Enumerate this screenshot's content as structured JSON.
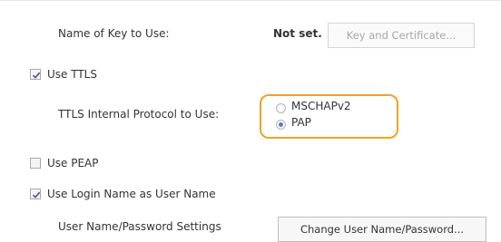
{
  "key": {
    "label": "Name of Key to Use:",
    "value": "Not set.",
    "button": "Key and Certificate..."
  },
  "ttls": {
    "checkbox_label": "Use TTLS",
    "checked": true,
    "protocol_label": "TTLS Internal Protocol to Use:",
    "options": [
      {
        "label": "MSCHAPv2",
        "selected": false
      },
      {
        "label": "PAP",
        "selected": true
      }
    ]
  },
  "peap": {
    "checkbox_label": "Use PEAP",
    "checked": false
  },
  "login": {
    "checkbox_label": "Use Login Name as User Name",
    "checked": true
  },
  "credentials": {
    "label": "User Name/Password Settings",
    "button": "Change User Name/Password..."
  },
  "colors": {
    "highlight": "#f0a32a",
    "check": "#3d5a8a",
    "radio_selected": "#5a7fb5"
  }
}
